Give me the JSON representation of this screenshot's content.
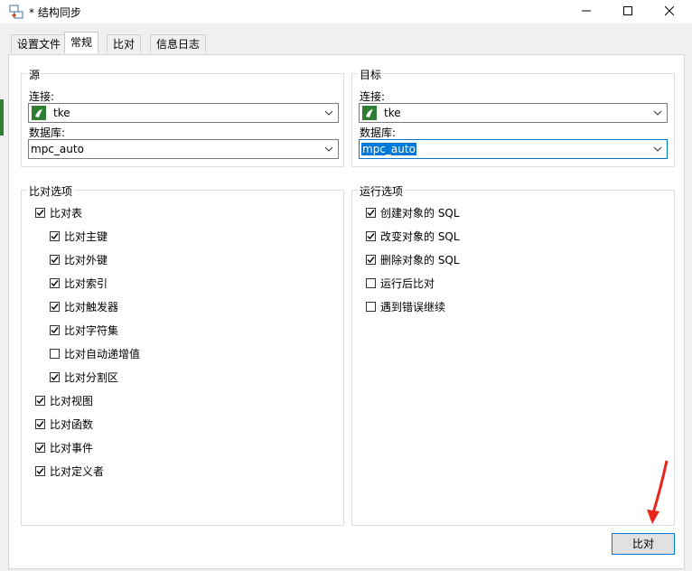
{
  "window": {
    "title": "* 结构同步"
  },
  "tabs": [
    "设置文件",
    "常规",
    "比对",
    "信息日志"
  ],
  "source": {
    "group_title": "源",
    "connection_label": "连接:",
    "connection_value": "tke",
    "database_label": "数据库:",
    "database_value": "mpc_auto"
  },
  "target": {
    "group_title": "目标",
    "connection_label": "连接:",
    "connection_value": "tke",
    "database_label": "数据库:",
    "database_value": "mpc_auto"
  },
  "compare_options": {
    "title": "比对选项",
    "items": [
      {
        "label": "比对表",
        "checked": true,
        "level": 0
      },
      {
        "label": "比对主键",
        "checked": true,
        "level": 1
      },
      {
        "label": "比对外键",
        "checked": true,
        "level": 1
      },
      {
        "label": "比对索引",
        "checked": true,
        "level": 1
      },
      {
        "label": "比对触发器",
        "checked": true,
        "level": 1
      },
      {
        "label": "比对字符集",
        "checked": true,
        "level": 1
      },
      {
        "label": "比对自动递增值",
        "checked": false,
        "level": 1
      },
      {
        "label": "比对分割区",
        "checked": true,
        "level": 1
      },
      {
        "label": "比对视图",
        "checked": true,
        "level": 0
      },
      {
        "label": "比对函数",
        "checked": true,
        "level": 0
      },
      {
        "label": "比对事件",
        "checked": true,
        "level": 0
      },
      {
        "label": "比对定义者",
        "checked": true,
        "level": 0
      }
    ]
  },
  "run_options": {
    "title": "运行选项",
    "items": [
      {
        "label": "创建对象的 SQL",
        "checked": true
      },
      {
        "label": "改变对象的 SQL",
        "checked": true
      },
      {
        "label": "删除对象的 SQL",
        "checked": true
      },
      {
        "label": "运行后比对",
        "checked": false
      },
      {
        "label": "遇到错误继续",
        "checked": false
      }
    ]
  },
  "buttons": {
    "compare": "比对"
  },
  "colors": {
    "accent": "#0078d7",
    "pointer": "#e8261c",
    "db_icon": "#2e7d32"
  }
}
